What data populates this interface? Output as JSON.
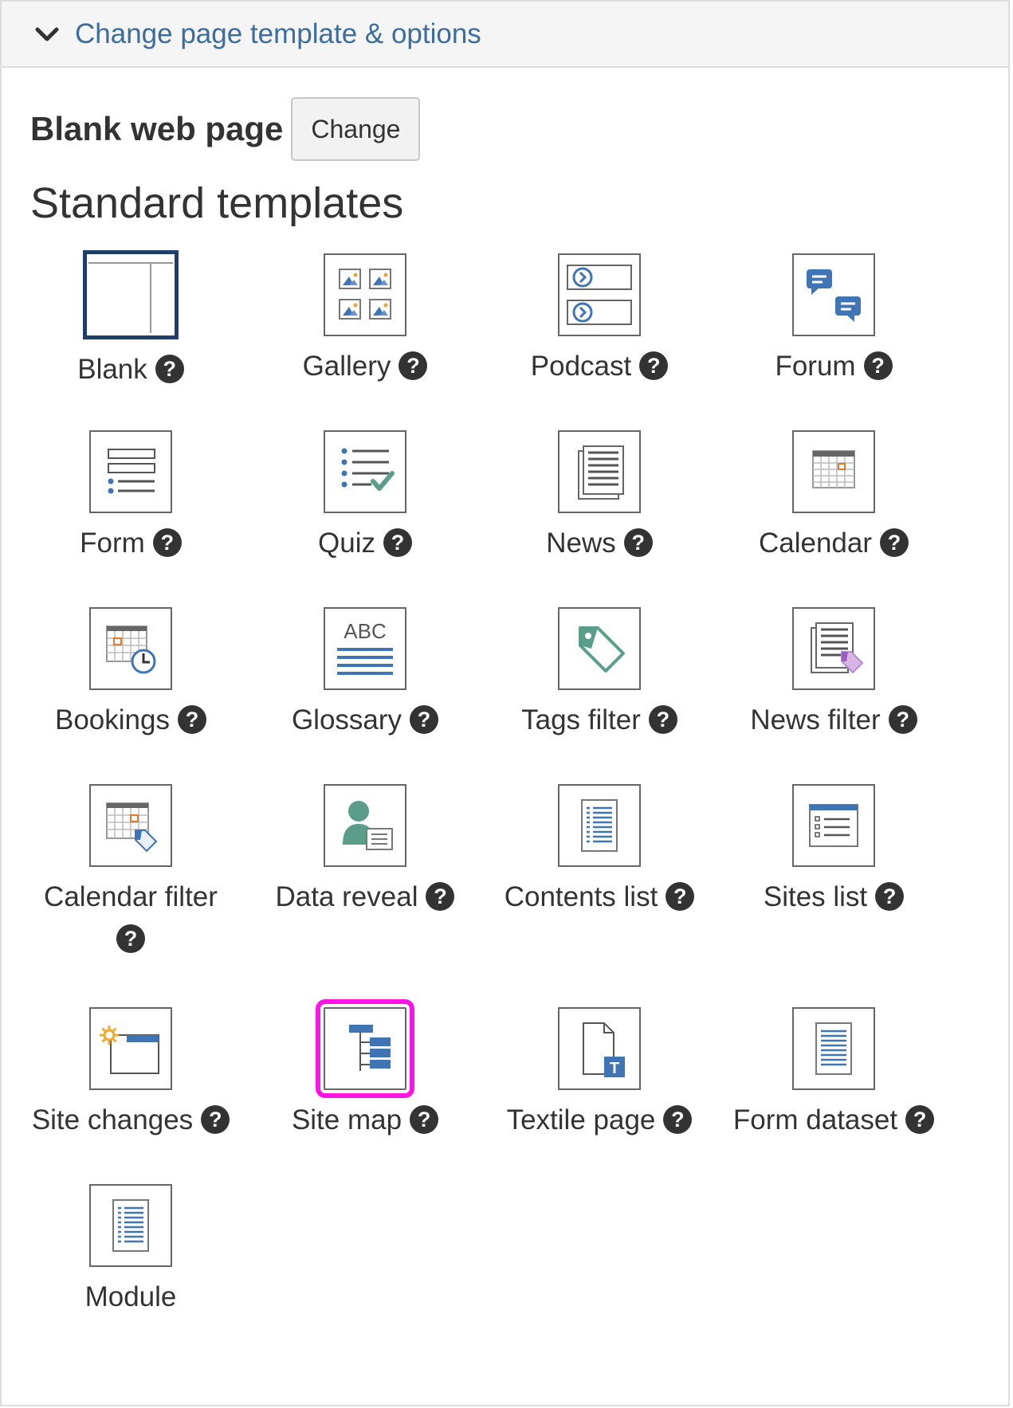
{
  "header": {
    "title": "Change page template & options"
  },
  "current": {
    "name": "Blank web page",
    "change_label": "Change"
  },
  "section": {
    "title": "Standard templates"
  },
  "help_glyph": "?",
  "accent_colors": {
    "selected_border": "#1f3e6b",
    "highlight": "#ff14e8",
    "link": "#3b6d9e",
    "icon_blue": "#3f74b5",
    "icon_green": "#5a9e8a"
  },
  "templates": [
    {
      "label": "Blank",
      "icon": "blank-layout-icon",
      "selected": true
    },
    {
      "label": "Gallery",
      "icon": "gallery-icon"
    },
    {
      "label": "Podcast",
      "icon": "podcast-icon"
    },
    {
      "label": "Forum",
      "icon": "forum-icon"
    },
    {
      "label": "Form",
      "icon": "form-icon"
    },
    {
      "label": "Quiz",
      "icon": "quiz-icon"
    },
    {
      "label": "News",
      "icon": "news-icon"
    },
    {
      "label": "Calendar",
      "icon": "calendar-icon"
    },
    {
      "label": "Bookings",
      "icon": "bookings-icon"
    },
    {
      "label": "Glossary",
      "icon": "glossary-icon",
      "icon_text": "ABC"
    },
    {
      "label": "Tags filter",
      "icon": "tag-icon"
    },
    {
      "label": "News filter",
      "icon": "news-filter-icon"
    },
    {
      "label": "Calendar filter",
      "icon": "calendar-filter-icon"
    },
    {
      "label": "Data reveal",
      "icon": "data-reveal-icon"
    },
    {
      "label": "Contents list",
      "icon": "contents-list-icon"
    },
    {
      "label": "Sites list",
      "icon": "sites-list-icon"
    },
    {
      "label": "Site changes",
      "icon": "site-changes-icon"
    },
    {
      "label": "Site map",
      "icon": "site-map-icon",
      "highlighted": true
    },
    {
      "label": "Textile page",
      "icon": "textile-page-icon",
      "icon_text": "T"
    },
    {
      "label": "Form dataset",
      "icon": "form-dataset-icon"
    },
    {
      "label": "Module",
      "icon": "module-icon",
      "no_help": true
    }
  ]
}
